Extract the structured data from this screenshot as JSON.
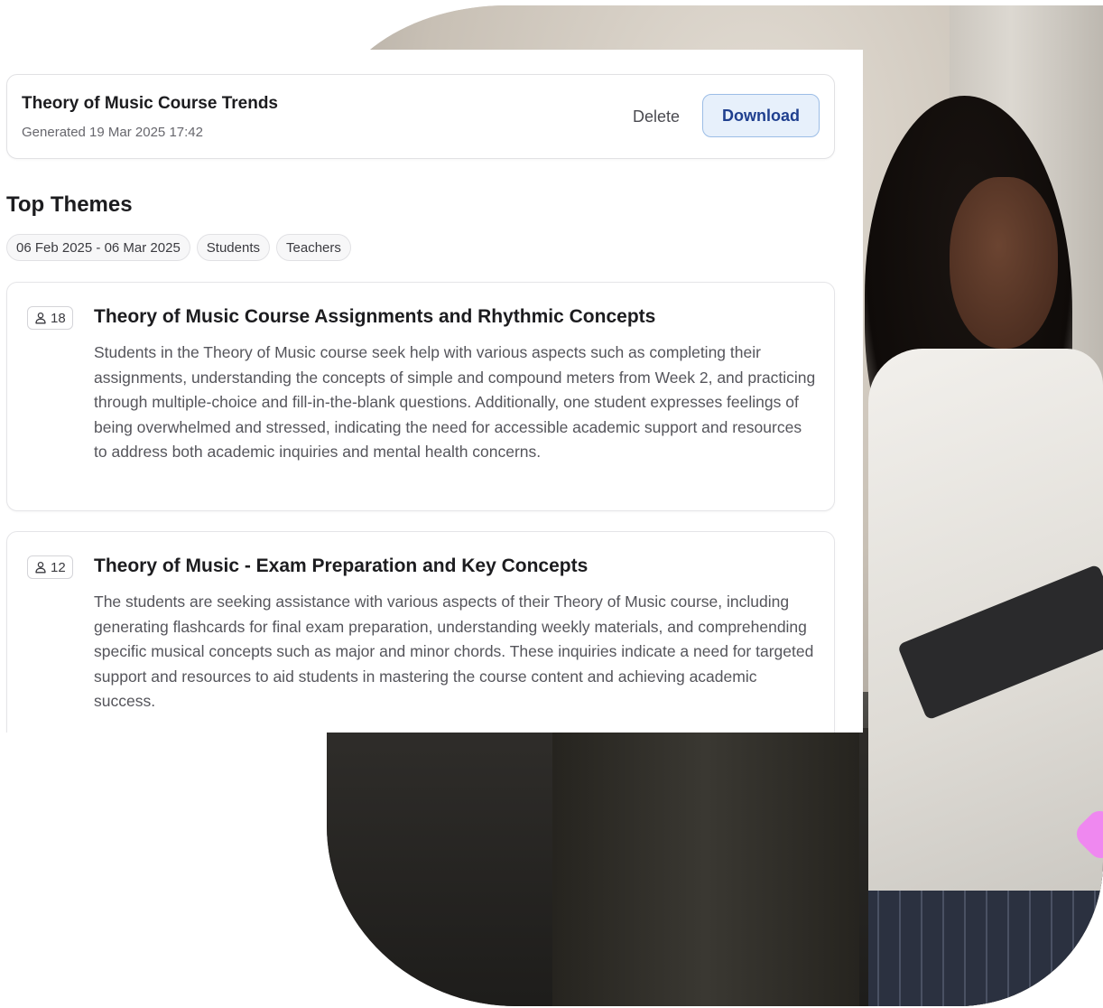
{
  "report": {
    "title": "Theory of Music Course Trends",
    "generated": "Generated 19 Mar 2025 17:42",
    "delete_label": "Delete",
    "download_label": "Download"
  },
  "section_title": "Top Themes",
  "filters": [
    "06 Feb 2025 - 06 Mar 2025",
    "Students",
    "Teachers"
  ],
  "themes": [
    {
      "count": "18",
      "title": "Theory of Music Course Assignments and Rhythmic Concepts",
      "body": "Students in the Theory of Music course seek help with various aspects such as completing their assignments, understanding the concepts of simple and compound meters from Week 2, and practicing through multiple-choice and fill-in-the-blank questions. Additionally, one student expresses feelings of being overwhelmed and stressed, indicating the need for accessible academic support and resources to address both academic inquiries and mental health concerns."
    },
    {
      "count": "12",
      "title": "Theory of Music - Exam Preparation and Key Concepts",
      "body": "The students are seeking assistance with various aspects of their Theory of Music course, including generating flashcards for final exam preparation, understanding weekly materials, and comprehending specific musical concepts such as major and minor chords. These inquiries indicate a need for targeted support and resources to aid students in mastering the course content and achieving academic success."
    }
  ],
  "icons": {
    "count": "user-icon"
  },
  "colors": {
    "download_bg": "#e7f0fb",
    "download_border": "#9cbde6",
    "download_text": "#1f3f8f",
    "accent_green": "#b5ef8d",
    "accent_pink": "#ef88f0"
  }
}
